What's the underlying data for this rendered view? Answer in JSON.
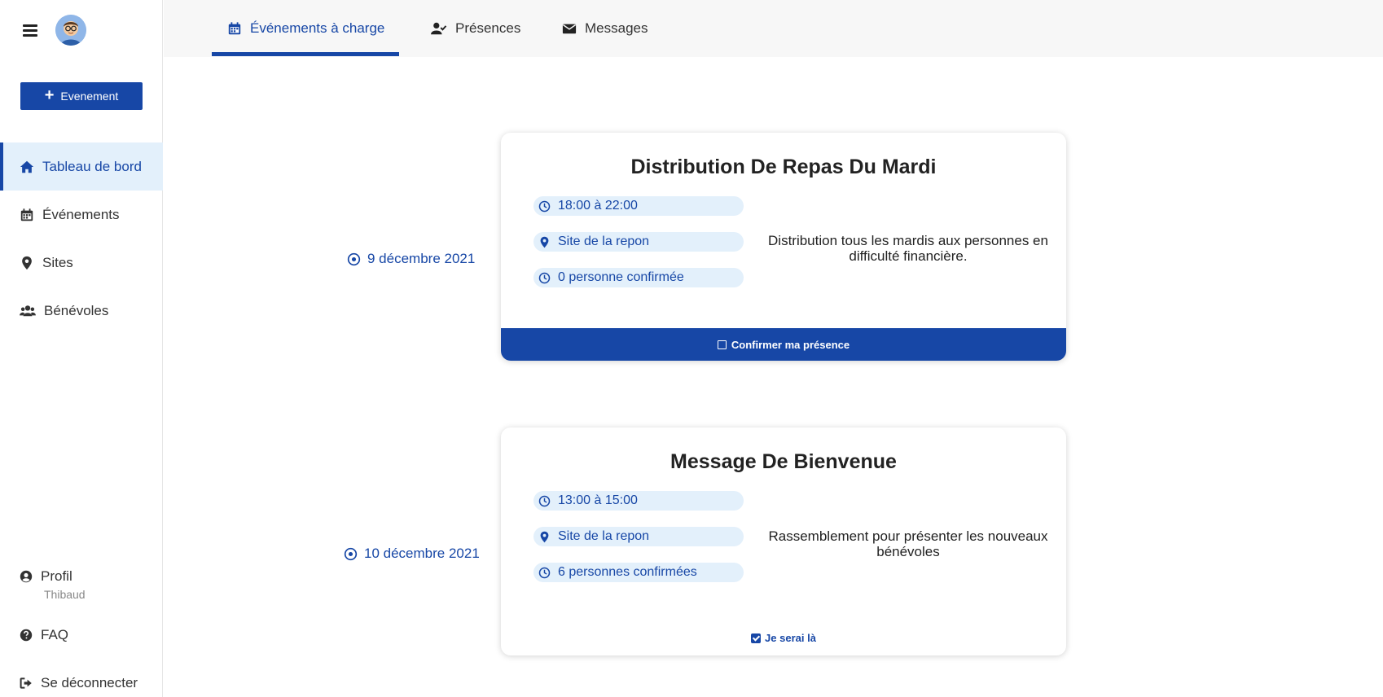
{
  "header": {
    "tabs": [
      {
        "label": "Événements à charge",
        "icon": "calendar-icon"
      },
      {
        "label": "Présences",
        "icon": "user-check-icon"
      },
      {
        "label": "Messages",
        "icon": "envelope-icon"
      }
    ]
  },
  "sidebar": {
    "add_button_label": "Evenement",
    "items": [
      {
        "label": "Tableau de bord",
        "icon": "home-icon"
      },
      {
        "label": "Événements",
        "icon": "calendar-icon"
      },
      {
        "label": "Sites",
        "icon": "map-pin-icon"
      },
      {
        "label": "Bénévoles",
        "icon": "users-icon"
      }
    ],
    "profile": {
      "label": "Profil",
      "username": "Thibaud"
    },
    "faq_label": "FAQ",
    "logout_label": "Se déconnecter"
  },
  "events": [
    {
      "date": "9 décembre 2021",
      "title": "Distribution De Repas Du Mardi",
      "time": "18:00 à 22:00",
      "site": "Site de la repon",
      "confirmed": "0 personne confirmée",
      "description": "Distribution tous les mardis aux personnes en difficulté financière.",
      "action": "Confirmer ma présence"
    },
    {
      "date": "10 décembre 2021",
      "title": "Message De Bienvenue",
      "time": "13:00 à 15:00",
      "site": "Site de la repon",
      "confirmed": "6 personnes confirmées",
      "description": "Rassemblement pour présenter les nouveaux bénévoles",
      "action": "Je serai là"
    }
  ],
  "colors": {
    "accent": "#1747a6",
    "pill_bg": "#e3f0fb",
    "topbar_bg": "#f7f7f7"
  }
}
